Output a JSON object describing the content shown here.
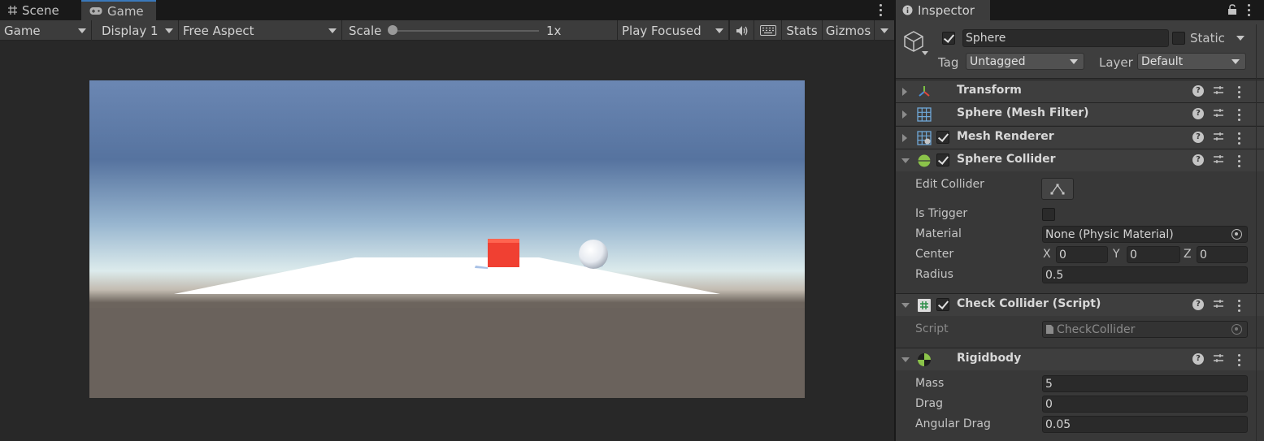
{
  "tabs": {
    "scene": "Scene",
    "game": "Game"
  },
  "toolbar": {
    "game_view_select": "Game",
    "display": "Display 1",
    "aspect": "Free Aspect",
    "scale_label": "Scale",
    "scale_value": "1x",
    "play_mode": "Play Focused",
    "stats": "Stats",
    "gizmos": "Gizmos"
  },
  "inspector": {
    "tab_title": "Inspector",
    "object_name": "Sphere",
    "static_label": "Static",
    "tag_label": "Tag",
    "tag_value": "Untagged",
    "layer_label": "Layer",
    "layer_value": "Default",
    "components": {
      "transform": "Transform",
      "mesh_filter": "Sphere (Mesh Filter)",
      "mesh_renderer": "Mesh Renderer",
      "sphere_collider": "Sphere Collider",
      "check_collider": "Check Collider (Script)",
      "rigidbody": "Rigidbody"
    },
    "sphere_collider": {
      "edit_collider_label": "Edit Collider",
      "is_trigger_label": "Is Trigger",
      "material_label": "Material",
      "material_value": "None (Physic Material)",
      "center_label": "Center",
      "x_label": "X",
      "x_value": "0",
      "y_label": "Y",
      "y_value": "0",
      "z_label": "Z",
      "z_value": "0",
      "radius_label": "Radius",
      "radius_value": "0.5"
    },
    "script": {
      "label": "Script",
      "value": "CheckCollider"
    },
    "rigidbody": {
      "mass_label": "Mass",
      "mass_value": "5",
      "drag_label": "Drag",
      "drag_value": "0",
      "angular_drag_label": "Angular Drag",
      "angular_drag_value": "0.05"
    }
  },
  "colors": {
    "accent": "#3a79bb",
    "cube": "#f04032",
    "sky_top": "#5d7aa7",
    "ground": "#6a625c",
    "panel": "#383838"
  }
}
